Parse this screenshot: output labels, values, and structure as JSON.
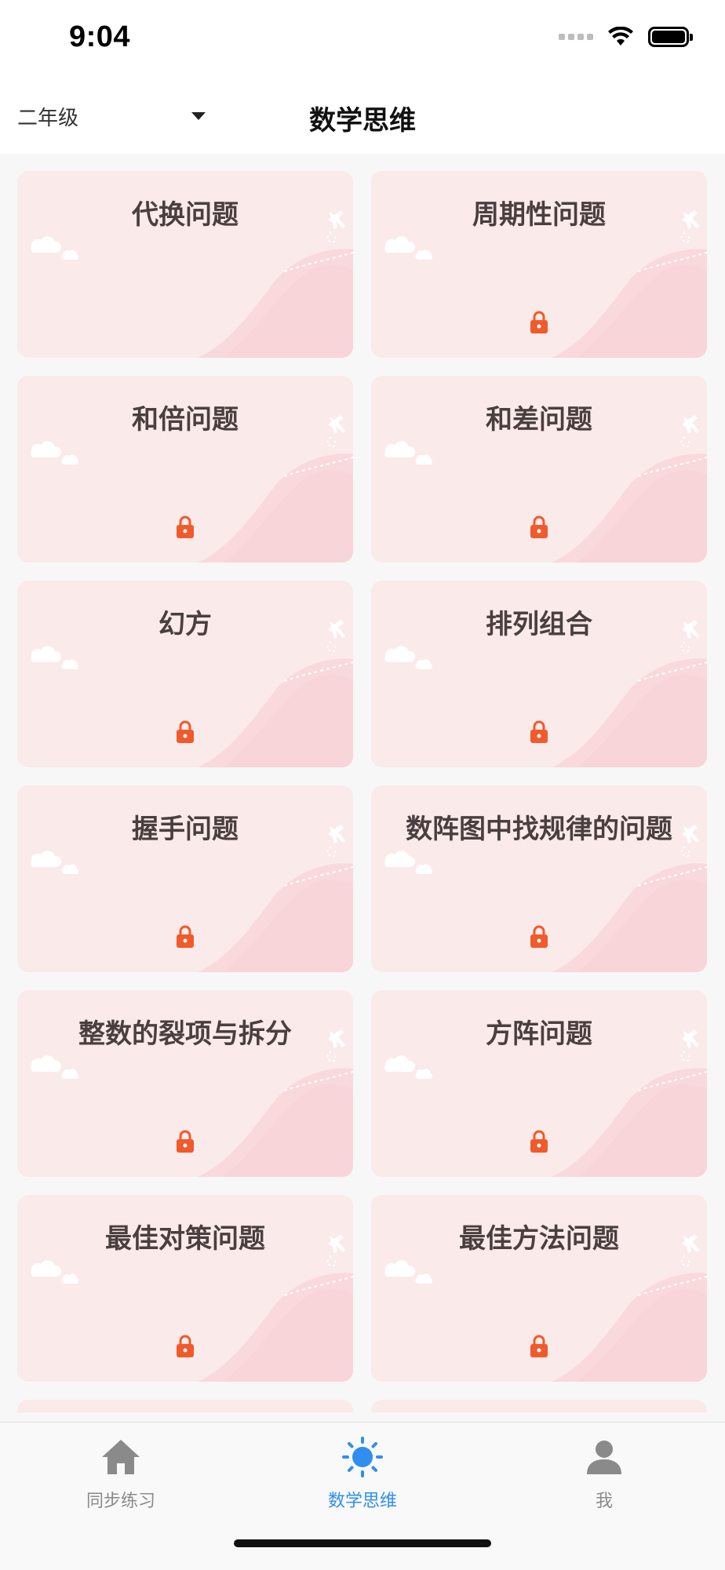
{
  "status_bar": {
    "time": "9:04"
  },
  "header": {
    "grade": "二年级",
    "title": "数学思维"
  },
  "topics": [
    {
      "title": "代换问题",
      "locked": false
    },
    {
      "title": "周期性问题",
      "locked": true
    },
    {
      "title": "和倍问题",
      "locked": true
    },
    {
      "title": "和差问题",
      "locked": true
    },
    {
      "title": "幻方",
      "locked": true
    },
    {
      "title": "排列组合",
      "locked": true
    },
    {
      "title": "握手问题",
      "locked": true
    },
    {
      "title": "数阵图中找规律的问题",
      "locked": true
    },
    {
      "title": "整数的裂项与拆分",
      "locked": true
    },
    {
      "title": "方阵问题",
      "locked": true
    },
    {
      "title": "最佳对策问题",
      "locked": true
    },
    {
      "title": "最佳方法问题",
      "locked": true
    }
  ],
  "tabs": [
    {
      "label": "同步练习",
      "icon": "home-icon",
      "active": false
    },
    {
      "label": "数学思维",
      "icon": "sun-icon",
      "active": true
    },
    {
      "label": "我",
      "icon": "person-icon",
      "active": false
    }
  ],
  "colors": {
    "card_bg": "#fbeaea",
    "lock": "#f15a2b",
    "accent": "#2f8ef0",
    "tab_inactive": "#8a8a8a"
  }
}
